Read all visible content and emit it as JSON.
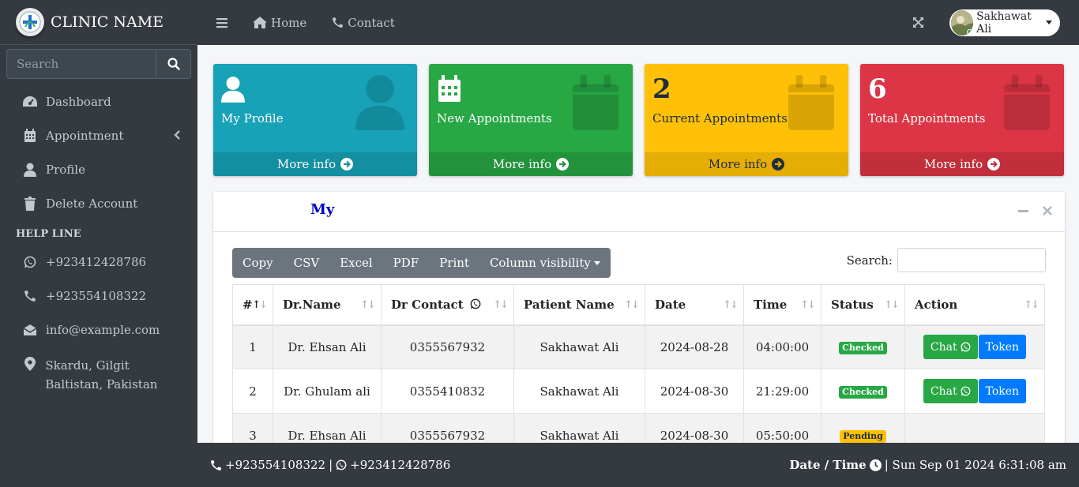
{
  "brand": {
    "name": "CLINIC NAME"
  },
  "sidebar": {
    "search_placeholder": "Search",
    "items": [
      {
        "label": "Dashboard",
        "icon": "tachometer-icon"
      },
      {
        "label": "Appointment",
        "icon": "calendar-icon"
      },
      {
        "label": "Profile",
        "icon": "user-icon"
      },
      {
        "label": "Delete Account",
        "icon": "trash-icon"
      }
    ],
    "helpline_header": "HELP LINE",
    "helpline": [
      {
        "label": "+923412428786",
        "icon": "whatsapp-icon"
      },
      {
        "label": "+923554108322",
        "icon": "phone-icon"
      },
      {
        "label": "info@example.com",
        "icon": "envelope-open-icon"
      },
      {
        "label": "Skardu, Gilgit Baltistan, Pakistan",
        "icon": "map-marker-icon"
      }
    ]
  },
  "topbar": {
    "home": "Home",
    "contact": "Contact",
    "user_name": "Sakhawat Ali"
  },
  "boxes": [
    {
      "value": "",
      "label": "My Profile",
      "footer": "More info",
      "color": "#17a2b8"
    },
    {
      "value": "",
      "label": "New Appointments",
      "footer": "More info",
      "color": "#28a745"
    },
    {
      "value": "2",
      "label": "Current Appointments",
      "footer": "More info",
      "color": "#ffc107"
    },
    {
      "value": "6",
      "label": "Total Appointments",
      "footer": "More info",
      "color": "#dc3545"
    }
  ],
  "card": {
    "title": "My",
    "buttons": [
      "Copy",
      "CSV",
      "Excel",
      "PDF",
      "Print",
      "Column visibility"
    ],
    "search_label": "Search:",
    "columns": [
      "#",
      "Dr.Name",
      "Dr Contact",
      "Patient Name",
      "Date",
      "Time",
      "Status",
      "Action"
    ],
    "rows": [
      {
        "n": "1",
        "dr": "Dr. Ehsan Ali",
        "contact": "0355567932",
        "patient": "Sakhawat Ali",
        "date": "2024-08-28",
        "time": "04:00:00",
        "status": "Checked"
      },
      {
        "n": "2",
        "dr": "Dr. Ghulam ali",
        "contact": "0355410832",
        "patient": "Sakhawat Ali",
        "date": "2024-08-30",
        "time": "21:29:00",
        "status": "Checked"
      },
      {
        "n": "3",
        "dr": "Dr. Ehsan Ali",
        "contact": "0355567932",
        "patient": "Sakhawat Ali",
        "date": "2024-08-30",
        "time": "05:50:00",
        "status": "Pending"
      }
    ],
    "chat_label": "Chat",
    "token_label": "Token"
  },
  "footer": {
    "phone": "+923554108322",
    "separator": "|",
    "whatsapp": "+923412428786",
    "datetime_label": "Date / Time",
    "datetime_value": "| Sun Sep 01 2024 6:31:08 am"
  }
}
